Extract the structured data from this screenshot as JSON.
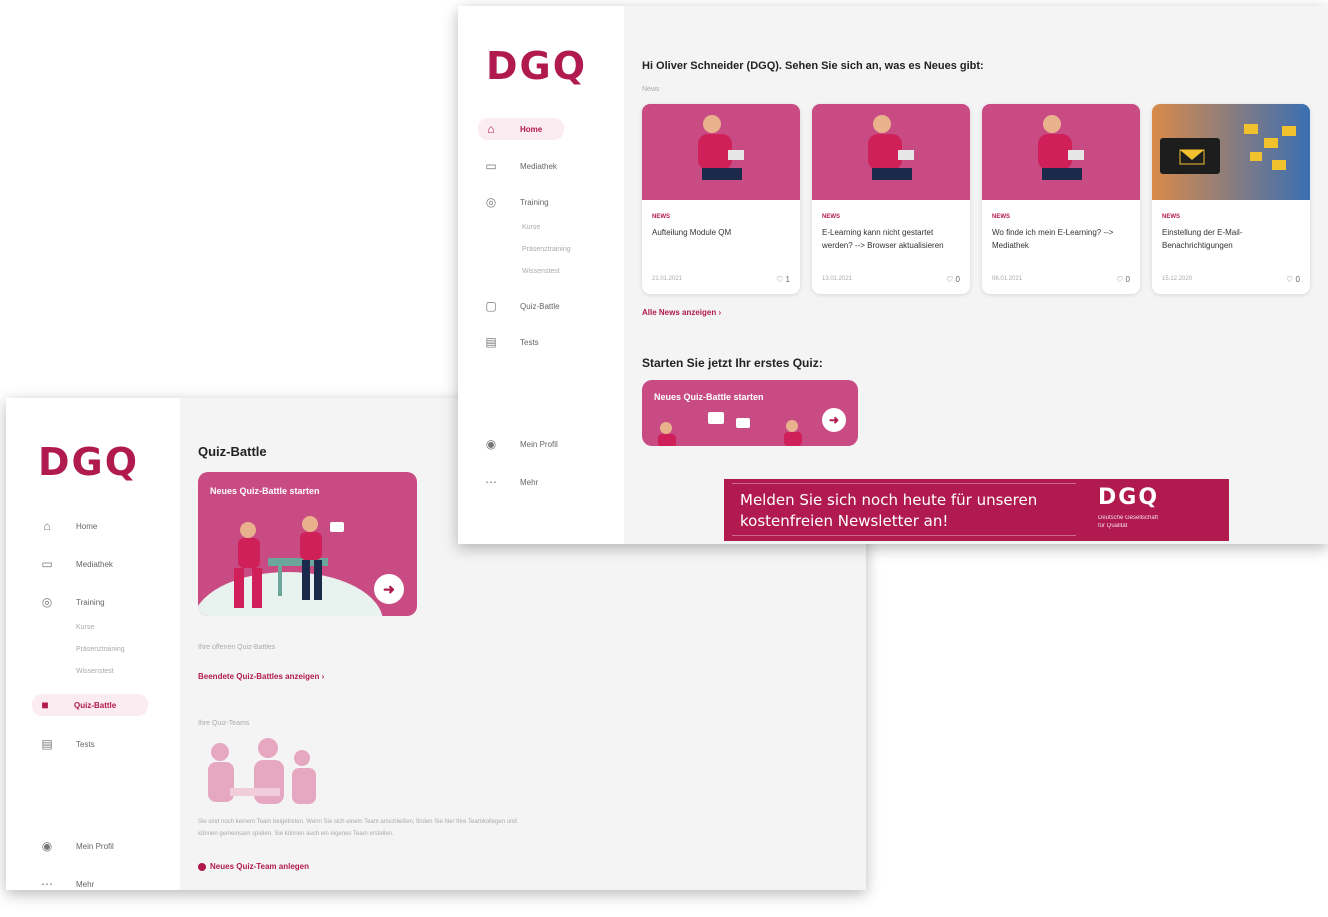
{
  "colors": {
    "brand": "#b01a4f",
    "card_pink": "#c94b84"
  },
  "back_window": {
    "logo": "DGQ",
    "nav": [
      {
        "label": "Home",
        "icon": "home-icon"
      },
      {
        "label": "Mediathek",
        "icon": "folder-icon"
      },
      {
        "label": "Training",
        "icon": "training-icon"
      },
      {
        "label": "Quiz-Battle",
        "icon": "bag-icon"
      },
      {
        "label": "Tests",
        "icon": "document-icon"
      }
    ],
    "training_sub": [
      "Kurse",
      "Präsenztraining",
      "Wissenstest"
    ],
    "bottom_nav": [
      {
        "label": "Mein Profil",
        "icon": "user-icon"
      },
      {
        "label": "Mehr",
        "icon": "more-icon"
      }
    ],
    "page_title": "Quiz-Battle",
    "quiz_card_title": "Neues Quiz-Battle starten",
    "open_battles_label": "Ihre offenen Quiz-Battles",
    "finished_battles_link": "Beendete Quiz-Battles anzeigen ›",
    "teams_label": "Ihre Quiz-Teams",
    "teams_text": "Sie sind noch keinem Team beigetreten. Wenn Sie sich einem Team anschließen, finden Sie hier Ihre Teamkollegen und können gemeinsam spielen. Sie können auch ein eigenes Team erstellen.",
    "new_team_link": "Neues Quiz-Team anlegen"
  },
  "front_window": {
    "logo": "DGQ",
    "nav": [
      {
        "label": "Home",
        "icon": "home-icon"
      },
      {
        "label": "Mediathek",
        "icon": "folder-icon"
      },
      {
        "label": "Training",
        "icon": "training-icon"
      },
      {
        "label": "Quiz-Battle",
        "icon": "bag-icon"
      },
      {
        "label": "Tests",
        "icon": "document-icon"
      }
    ],
    "training_sub": [
      "Kurse",
      "Präsenztraining",
      "Wissenstest"
    ],
    "bottom_nav": [
      {
        "label": "Mein Profil",
        "icon": "user-icon"
      },
      {
        "label": "Mehr",
        "icon": "more-icon"
      }
    ],
    "greeting": "Hi Oliver Schneider (DGQ). Sehen Sie sich an, was es Neues gibt:",
    "news_section_label": "News",
    "news_cards": [
      {
        "tag": "NEWS",
        "title": "Aufteilung Module QM",
        "date": "21.01.2021",
        "likes": "1"
      },
      {
        "tag": "NEWS",
        "title": "E-Learning kann nicht gestartet werden? --> Browser aktualisieren",
        "date": "13.01.2021",
        "likes": "0"
      },
      {
        "tag": "NEWS",
        "title": "Wo finde ich mein E-Learning? --> Mediathek",
        "date": "06.01.2021",
        "likes": "0"
      },
      {
        "tag": "NEWS",
        "title": "Einstellung der E-Mail-Benachrichtigungen",
        "date": "15.12.2020",
        "likes": "0"
      }
    ],
    "all_news_link": "Alle News anzeigen ›",
    "quiz_heading": "Starten Sie jetzt Ihr erstes Quiz:",
    "quiz_card_title": "Neues Quiz-Battle starten"
  },
  "banner": {
    "line1": "Melden Sie sich noch heute für unseren",
    "line2": "kostenfreien Newsletter an!",
    "logo": "DGQ",
    "logo_sub1": "Deutsche Gesellschaft",
    "logo_sub2": "für Qualität"
  }
}
